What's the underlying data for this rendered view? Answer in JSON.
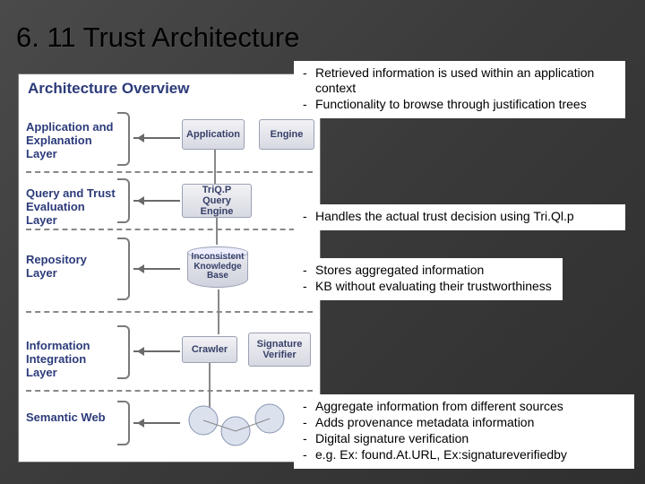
{
  "title": "6. 11 Trust Architecture",
  "overview_title": "Architecture Overview",
  "layers": {
    "l1a": "Application and",
    "l1b": "Explanation Layer",
    "l2a": "Query and Trust",
    "l2b": "Evaluation Layer",
    "l3a": "Repository Layer",
    "l4a": "Information",
    "l4b": "Integration Layer",
    "l5a": "Semantic Web"
  },
  "boxes": {
    "application": "Application",
    "engine": "Engine",
    "query_a": "TriQ.P",
    "query_b": "Query Engine",
    "kb_a": "Inconsistent",
    "kb_b": "Knowledge",
    "kb_c": "Base",
    "crawler": "Crawler",
    "sig_a": "Signature",
    "sig_b": "Verifier"
  },
  "notes": {
    "n1a": "Retrieved information is used within an application  context",
    "n1b": "Functionality to browse through justification trees",
    "n2a": "Handles the actual trust decision using Tri.Ql.p",
    "n3a": "Stores aggregated information",
    "n3b": "KB without evaluating their trustworthiness",
    "n4a": "Aggregate information from different sources",
    "n4b": "Adds provenance metadata information",
    "n4c": "Digital signature verification",
    "n4d": "e.g. Ex: found.At.URL, Ex:signatureverifiedby"
  }
}
